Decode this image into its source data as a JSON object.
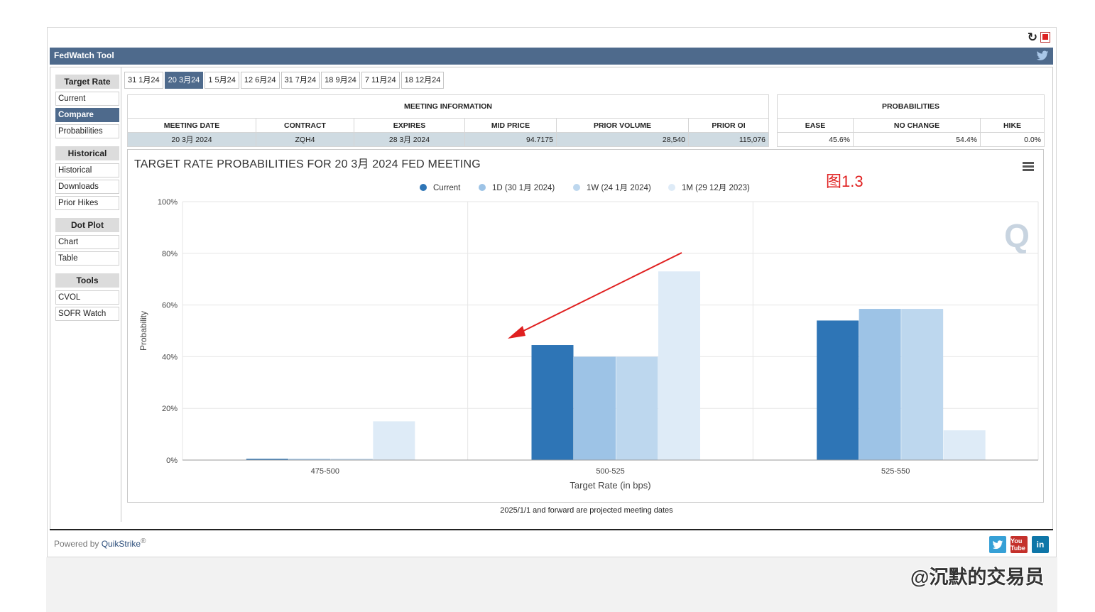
{
  "app": {
    "title": "FedWatch Tool"
  },
  "sidebar": {
    "groups": [
      {
        "header": "Target Rate",
        "items": [
          "Current",
          "Compare",
          "Probabilities"
        ],
        "active": "Compare"
      },
      {
        "header": "Historical",
        "items": [
          "Historical",
          "Downloads",
          "Prior Hikes"
        ]
      },
      {
        "header": "Dot Plot",
        "items": [
          "Chart",
          "Table"
        ]
      },
      {
        "header": "Tools",
        "items": [
          "CVOL",
          "SOFR Watch"
        ]
      }
    ]
  },
  "tabs": [
    "31 1月24",
    "20 3月24",
    "1 5月24",
    "12 6月24",
    "31 7月24",
    "18 9月24",
    "7 11月24",
    "18 12月24"
  ],
  "active_tab": "20 3月24",
  "meeting_info": {
    "title": "MEETING INFORMATION",
    "headers": [
      "MEETING DATE",
      "CONTRACT",
      "EXPIRES",
      "MID PRICE",
      "PRIOR VOLUME",
      "PRIOR OI"
    ],
    "row": [
      "20 3月 2024",
      "ZQH4",
      "28 3月 2024",
      "94.7175",
      "28,540",
      "115,076"
    ]
  },
  "probabilities": {
    "title": "PROBABILITIES",
    "headers": [
      "EASE",
      "NO CHANGE",
      "HIKE"
    ],
    "row": [
      "45.6%",
      "54.4%",
      "0.0%"
    ]
  },
  "chart": {
    "title": "TARGET RATE PROBABILITIES FOR 20 3月 2024 FED MEETING",
    "annotation": "图1.3"
  },
  "chart_data": {
    "type": "bar",
    "categories": [
      "475-500",
      "500-525",
      "525-550"
    ],
    "series": [
      {
        "name": "Current",
        "color": "#2e75b6",
        "values": [
          0.5,
          44.5,
          54.0
        ]
      },
      {
        "name": "1D (30 1月 2024)",
        "color": "#9dc3e6",
        "values": [
          0.5,
          40.0,
          58.5
        ]
      },
      {
        "name": "1W (24 1月 2024)",
        "color": "#bdd7ee",
        "values": [
          0.5,
          40.0,
          58.5
        ]
      },
      {
        "name": "1M (29 12月 2023)",
        "color": "#deebf7",
        "values": [
          15.0,
          73.0,
          11.5
        ]
      }
    ],
    "xlabel": "Target Rate (in bps)",
    "ylabel": "Probability",
    "ylim": [
      0,
      100
    ],
    "yticks": [
      "0%",
      "20%",
      "40%",
      "60%",
      "80%",
      "100%"
    ],
    "grid": true,
    "legend": "top-center"
  },
  "footnote": "2025/1/1 and forward are projected meeting dates",
  "footer": {
    "powered_by": "Powered by ",
    "brand": "QuikStrike",
    "reg": "®"
  },
  "social": {
    "youtube": "You Tube",
    "linkedin": "in"
  },
  "watermark": "@沉默的交易员"
}
